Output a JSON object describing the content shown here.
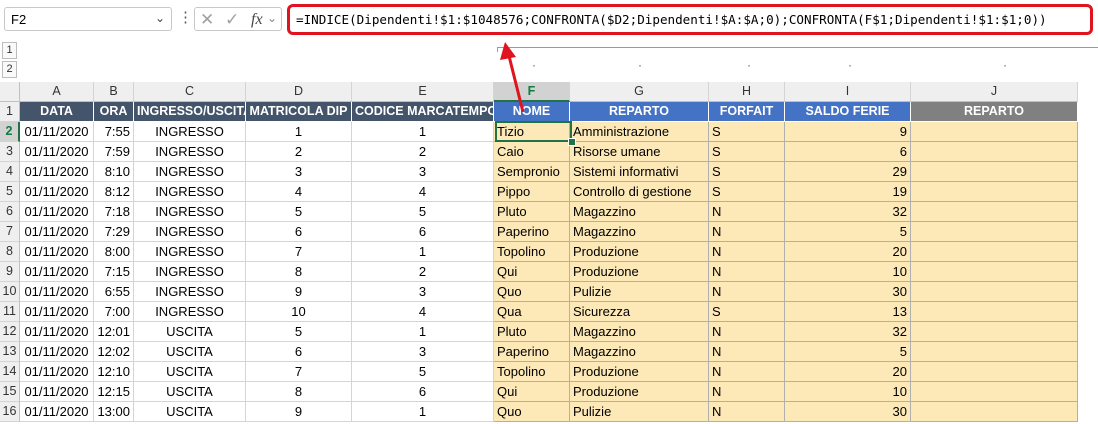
{
  "formula_bar": {
    "name_box": "F2",
    "name_box_dropdown_icon": "chevron-down-icon",
    "cancel_icon": "close-icon",
    "enter_icon": "checkmark-icon",
    "fx_label": "fx",
    "formula": "=INDICE(Dipendenti!$1:$1048576;CONFRONTA($D2;Dipendenti!$A:$A;0);CONFRONTA(F$1;Dipendenti!$1:$1;0))"
  },
  "outline": {
    "levels": [
      "1",
      "2"
    ]
  },
  "columns": [
    "A",
    "B",
    "C",
    "D",
    "E",
    "F",
    "G",
    "H",
    "I",
    "J"
  ],
  "selected_column": "F",
  "header_row": [
    "DATA",
    "ORA",
    "INGRESSO/USCITA",
    "MATRICOLA DIP",
    "CODICE MARCATEMPO",
    "NOME",
    "REPARTO",
    "FORFAIT",
    "SALDO FERIE",
    "REPARTO"
  ],
  "rows": [
    {
      "n": "2",
      "a": "01/11/2020",
      "b": "7:55",
      "c": "INGRESSO",
      "d": "1",
      "e": "1",
      "f": "Tizio",
      "g": "Amministrazione",
      "h": "S",
      "i": "9",
      "j": ""
    },
    {
      "n": "3",
      "a": "01/11/2020",
      "b": "7:59",
      "c": "INGRESSO",
      "d": "2",
      "e": "2",
      "f": "Caio",
      "g": "Risorse umane",
      "h": "S",
      "i": "6",
      "j": ""
    },
    {
      "n": "4",
      "a": "01/11/2020",
      "b": "8:10",
      "c": "INGRESSO",
      "d": "3",
      "e": "3",
      "f": "Sempronio",
      "g": "Sistemi informativi",
      "h": "S",
      "i": "29",
      "j": ""
    },
    {
      "n": "5",
      "a": "01/11/2020",
      "b": "8:12",
      "c": "INGRESSO",
      "d": "4",
      "e": "4",
      "f": "Pippo",
      "g": "Controllo di gestione",
      "h": "S",
      "i": "19",
      "j": ""
    },
    {
      "n": "6",
      "a": "01/11/2020",
      "b": "7:18",
      "c": "INGRESSO",
      "d": "5",
      "e": "5",
      "f": "Pluto",
      "g": "Magazzino",
      "h": "N",
      "i": "32",
      "j": ""
    },
    {
      "n": "7",
      "a": "01/11/2020",
      "b": "7:29",
      "c": "INGRESSO",
      "d": "6",
      "e": "6",
      "f": "Paperino",
      "g": "Magazzino",
      "h": "N",
      "i": "5",
      "j": ""
    },
    {
      "n": "8",
      "a": "01/11/2020",
      "b": "8:00",
      "c": "INGRESSO",
      "d": "7",
      "e": "1",
      "f": "Topolino",
      "g": "Produzione",
      "h": "N",
      "i": "20",
      "j": ""
    },
    {
      "n": "9",
      "a": "01/11/2020",
      "b": "7:15",
      "c": "INGRESSO",
      "d": "8",
      "e": "2",
      "f": "Qui",
      "g": "Produzione",
      "h": "N",
      "i": "10",
      "j": ""
    },
    {
      "n": "10",
      "a": "01/11/2020",
      "b": "6:55",
      "c": "INGRESSO",
      "d": "9",
      "e": "3",
      "f": "Quo",
      "g": "Pulizie",
      "h": "N",
      "i": "30",
      "j": ""
    },
    {
      "n": "11",
      "a": "01/11/2020",
      "b": "7:00",
      "c": "INGRESSO",
      "d": "10",
      "e": "4",
      "f": "Qua",
      "g": "Sicurezza",
      "h": "S",
      "i": "13",
      "j": ""
    },
    {
      "n": "12",
      "a": "01/11/2020",
      "b": "12:01",
      "c": "USCITA",
      "d": "5",
      "e": "1",
      "f": "Pluto",
      "g": "Magazzino",
      "h": "N",
      "i": "32",
      "j": ""
    },
    {
      "n": "13",
      "a": "01/11/2020",
      "b": "12:02",
      "c": "USCITA",
      "d": "6",
      "e": "3",
      "f": "Paperino",
      "g": "Magazzino",
      "h": "N",
      "i": "5",
      "j": ""
    },
    {
      "n": "14",
      "a": "01/11/2020",
      "b": "12:10",
      "c": "USCITA",
      "d": "7",
      "e": "5",
      "f": "Topolino",
      "g": "Produzione",
      "h": "N",
      "i": "20",
      "j": ""
    },
    {
      "n": "15",
      "a": "01/11/2020",
      "b": "12:15",
      "c": "USCITA",
      "d": "8",
      "e": "6",
      "f": "Qui",
      "g": "Produzione",
      "h": "N",
      "i": "10",
      "j": ""
    },
    {
      "n": "16",
      "a": "01/11/2020",
      "b": "13:00",
      "c": "USCITA",
      "d": "9",
      "e": "1",
      "f": "Quo",
      "g": "Pulizie",
      "h": "N",
      "i": "30",
      "j": ""
    }
  ],
  "annotation": {
    "color": "#e0141e",
    "arrow_icon": "red-arrow-icon"
  }
}
